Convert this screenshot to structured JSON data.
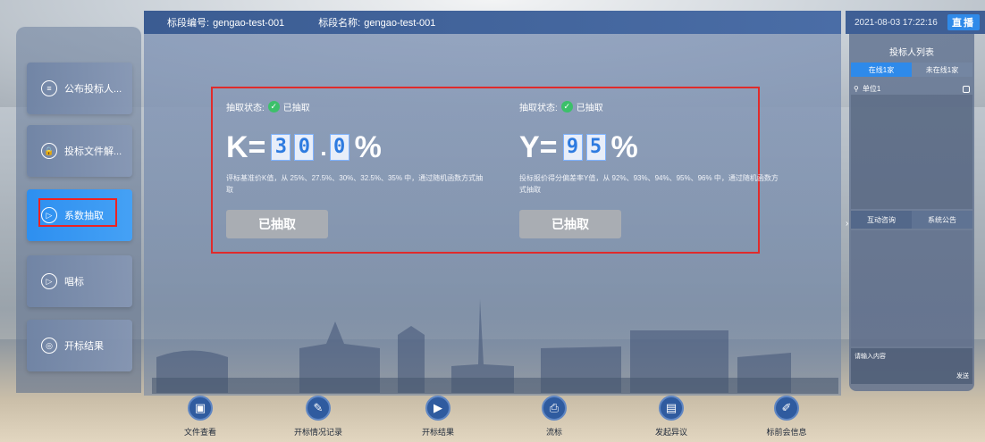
{
  "header": {
    "section_no_label": "标段编号:",
    "section_no": "gengao-test-001",
    "section_name_label": "标段名称:",
    "section_name": "gengao-test-001",
    "datetime": "2021-08-03 17:22:16",
    "live_label": "直播"
  },
  "sidebar": {
    "items": [
      {
        "label": "公布投标人...",
        "icon": "list-icon"
      },
      {
        "label": "投标文件解...",
        "icon": "lock-icon"
      },
      {
        "label": "系数抽取",
        "icon": "play-icon"
      },
      {
        "label": "唱标",
        "icon": "play-icon"
      },
      {
        "label": "开标结果",
        "icon": "result-icon"
      }
    ]
  },
  "extraction": {
    "k": {
      "status_label": "抽取状态:",
      "status": "已抽取",
      "var": "K=",
      "digits": [
        "3",
        "0",
        "0"
      ],
      "dot": ".",
      "pct": "%",
      "desc": "评标基准价K值，从 25%、27.5%、30%、32.5%、35% 中，通过随机函数方式抽取",
      "button": "已抽取"
    },
    "y": {
      "status_label": "抽取状态:",
      "status": "已抽取",
      "var": "Y=",
      "digits": [
        "9",
        "5"
      ],
      "pct": "%",
      "desc": "投标报价得分偏差率Y值，从 92%、93%、94%、95%、96% 中，通过随机函数方式抽取",
      "button": "已抽取"
    }
  },
  "right_panel": {
    "title": "投标人列表",
    "tab_online": "在线1家",
    "tab_offline": "未在线1家",
    "user": "单位1",
    "tab_interact": "互动咨询",
    "tab_notice": "系统公告",
    "input_placeholder": "请输入内容",
    "send_label": "发送"
  },
  "bottom_tools": [
    {
      "label": "文件查看",
      "icon": "file-icon"
    },
    {
      "label": "开标情况记录",
      "icon": "record-icon"
    },
    {
      "label": "开标结果",
      "icon": "result-icon"
    },
    {
      "label": "流标",
      "icon": "fail-icon"
    },
    {
      "label": "发起异议",
      "icon": "objection-icon"
    },
    {
      "label": "标前会信息",
      "icon": "edit-icon"
    }
  ]
}
